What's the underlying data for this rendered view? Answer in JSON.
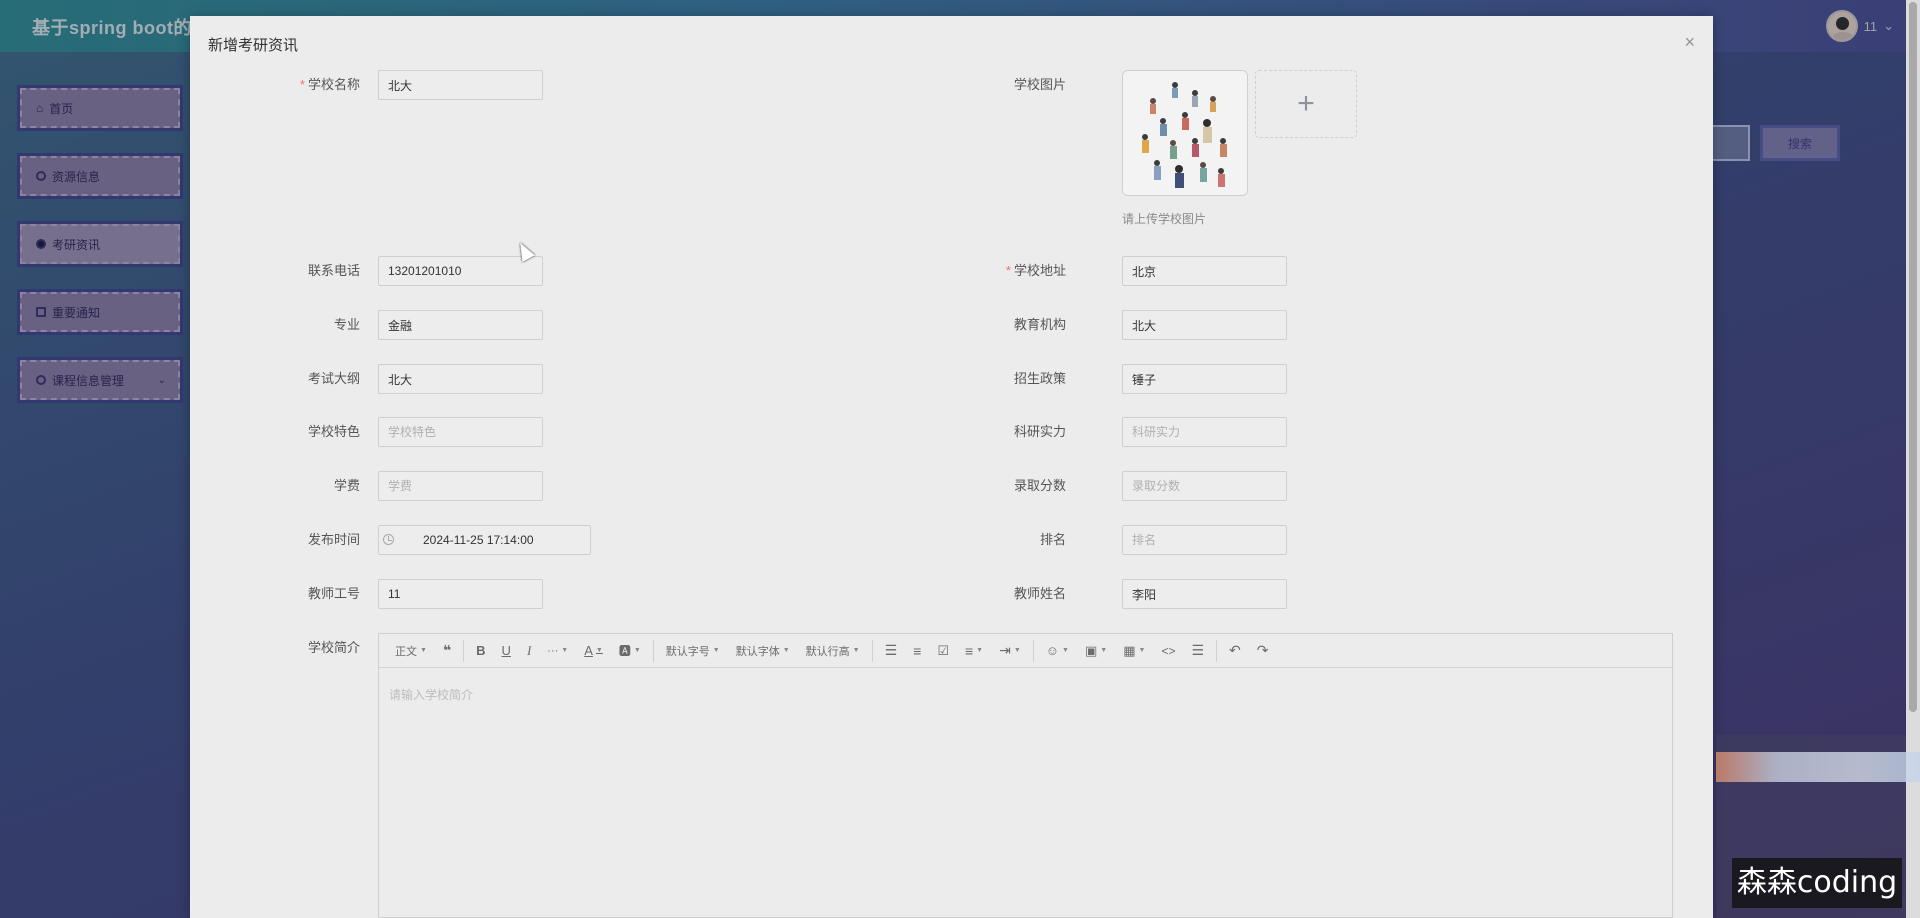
{
  "app": {
    "title": "基于spring boot的",
    "user": "11"
  },
  "sidebar": {
    "items": [
      {
        "label": "首页",
        "icon": "home-icon"
      },
      {
        "label": "资源信息",
        "icon": "resource-icon"
      },
      {
        "label": "考研资讯",
        "icon": "news-icon",
        "active": true
      },
      {
        "label": "重要通知",
        "icon": "notice-icon"
      },
      {
        "label": "课程信息管理",
        "icon": "course-icon"
      }
    ]
  },
  "background": {
    "search_button": "搜索"
  },
  "dialog": {
    "title": "新增考研资讯",
    "close": "×",
    "fields": {
      "school_name": {
        "label": "学校名称",
        "value": "北大",
        "required": true
      },
      "school_image": {
        "label": "学校图片",
        "tip": "请上传学校图片",
        "add": "+"
      },
      "phone": {
        "label": "联系电话",
        "value": "13201201010"
      },
      "address": {
        "label": "学校地址",
        "value": "北京",
        "required": true
      },
      "major": {
        "label": "专业",
        "value": "金融"
      },
      "institution": {
        "label": "教育机构",
        "value": "北大"
      },
      "syllabus": {
        "label": "考试大纲",
        "value": "北大"
      },
      "policy": {
        "label": "招生政策",
        "value": "锤子"
      },
      "features": {
        "label": "学校特色",
        "placeholder": "学校特色"
      },
      "research": {
        "label": "科研实力",
        "placeholder": "科研实力"
      },
      "tuition": {
        "label": "学费",
        "placeholder": "学费"
      },
      "score": {
        "label": "录取分数",
        "placeholder": "录取分数"
      },
      "publish_time": {
        "label": "发布时间",
        "value": "2024-11-25 17:14:00"
      },
      "rank": {
        "label": "排名",
        "placeholder": "排名"
      },
      "teacher_id": {
        "label": "教师工号",
        "value": "11"
      },
      "teacher_name": {
        "label": "教师姓名",
        "value": "李阳"
      },
      "intro": {
        "label": "学校简介",
        "placeholder": "请输入学校简介"
      }
    },
    "toolbar": {
      "paragraph": "正文",
      "font_size": "默认字号",
      "font_family": "默认字体",
      "line_height": "默认行高"
    }
  },
  "watermark": "森森coding"
}
